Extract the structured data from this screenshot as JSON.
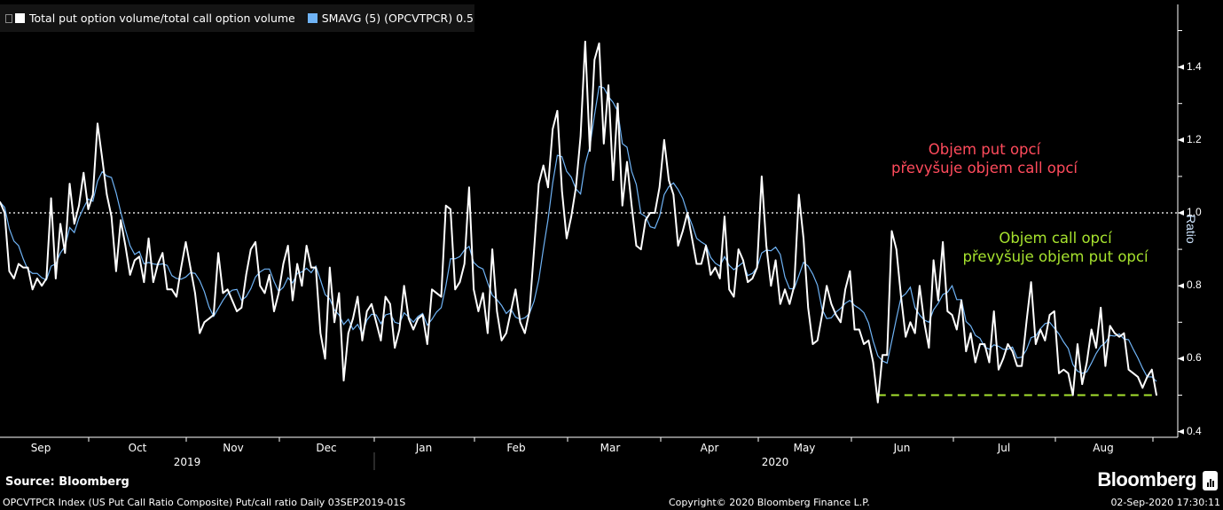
{
  "legend": {
    "series1": "Total put option volume/total call option volume",
    "series2": "SMAVG (5) (OPCVTPCR) 0.5",
    "series1_color": "#ffffff",
    "series2_color": "#6fb3f5"
  },
  "annotations": {
    "put_line1": "Objem put opcí",
    "put_line2": "převyšuje objem call opcí",
    "put_color": "#ff4b5c",
    "call_line1": "Objem call opcí",
    "call_line2": "převyšuje objem put opcí",
    "call_color": "#a6e22e"
  },
  "footer": {
    "source": "Source: Bloomberg",
    "description": "OPCVTPCR Index (US Put Call Ratio Composite) Put/call ratio  Daily 03SEP2019-01S",
    "copyright": "Copyright© 2020 Bloomberg Finance L.P.",
    "timestamp": "02-Sep-2020 17:30:11",
    "logo": "Bloomberg"
  },
  "chart_data": {
    "type": "line",
    "ylabel": "Ratio",
    "ylim": [
      0.4,
      1.52
    ],
    "yticks": [
      "1.4",
      "1.2",
      "1.0",
      "0.8",
      "0.6",
      "0.4"
    ],
    "xticks": [
      "Sep",
      "Oct",
      "Nov",
      "Dec",
      "Jan",
      "Feb",
      "Mar",
      "Apr",
      "May",
      "Jun",
      "Jul",
      "Aug"
    ],
    "years": [
      "2019",
      "2020"
    ],
    "reference_line": 1.0,
    "support_line": 0.5,
    "sma_period": 5,
    "series": [
      {
        "name": "Total put option volume/total call option volume",
        "color": "#ffffff",
        "values": [
          1.03,
          1.0,
          0.84,
          0.82,
          0.86,
          0.85,
          0.85,
          0.79,
          0.82,
          0.8,
          0.82,
          1.04,
          0.82,
          0.97,
          0.89,
          1.08,
          0.97,
          1.02,
          1.11,
          1.01,
          1.05,
          1.245,
          1.15,
          1.05,
          0.99,
          0.84,
          0.98,
          0.91,
          0.83,
          0.87,
          0.88,
          0.81,
          0.93,
          0.81,
          0.86,
          0.89,
          0.79,
          0.79,
          0.77,
          0.85,
          0.92,
          0.85,
          0.78,
          0.67,
          0.7,
          0.71,
          0.72,
          0.89,
          0.78,
          0.79,
          0.76,
          0.73,
          0.74,
          0.83,
          0.9,
          0.92,
          0.8,
          0.78,
          0.83,
          0.73,
          0.78,
          0.86,
          0.91,
          0.76,
          0.86,
          0.8,
          0.91,
          0.85,
          0.85,
          0.67,
          0.6,
          0.85,
          0.7,
          0.78,
          0.54,
          0.67,
          0.71,
          0.77,
          0.65,
          0.73,
          0.75,
          0.7,
          0.65,
          0.77,
          0.75,
          0.63,
          0.68,
          0.8,
          0.71,
          0.68,
          0.71,
          0.72,
          0.64,
          0.79,
          0.78,
          0.77,
          1.02,
          1.01,
          0.79,
          0.81,
          0.86,
          1.07,
          0.79,
          0.73,
          0.78,
          0.67,
          0.9,
          0.73,
          0.65,
          0.67,
          0.73,
          0.79,
          0.7,
          0.67,
          0.73,
          0.9,
          1.08,
          1.13,
          1.07,
          1.23,
          1.28,
          1.06,
          0.93,
          0.99,
          1.07,
          1.21,
          1.47,
          1.17,
          1.42,
          1.465,
          1.19,
          1.35,
          1.09,
          1.3,
          1.02,
          1.14,
          1.02,
          0.91,
          0.9,
          0.98,
          1.0,
          1.0,
          1.07,
          1.2,
          1.09,
          1.05,
          0.91,
          0.95,
          1.0,
          0.93,
          0.86,
          0.86,
          0.91,
          0.83,
          0.85,
          0.82,
          0.99,
          0.79,
          0.77,
          0.9,
          0.87,
          0.81,
          0.82,
          0.85,
          1.1,
          0.91,
          0.8,
          0.87,
          0.75,
          0.79,
          0.75,
          0.8,
          1.05,
          0.93,
          0.74,
          0.64,
          0.65,
          0.72,
          0.8,
          0.75,
          0.72,
          0.7,
          0.79,
          0.84,
          0.68,
          0.68,
          0.64,
          0.65,
          0.59,
          0.48,
          0.61,
          0.61,
          0.95,
          0.9,
          0.77,
          0.66,
          0.7,
          0.67,
          0.8,
          0.7,
          0.63,
          0.87,
          0.76,
          0.92,
          0.73,
          0.72,
          0.68,
          0.76,
          0.62,
          0.67,
          0.59,
          0.64,
          0.64,
          0.59,
          0.73,
          0.57,
          0.6,
          0.64,
          0.62,
          0.58,
          0.58,
          0.7,
          0.81,
          0.64,
          0.68,
          0.65,
          0.72,
          0.73,
          0.56,
          0.57,
          0.56,
          0.5,
          0.64,
          0.53,
          0.59,
          0.68,
          0.63,
          0.74,
          0.58,
          0.69,
          0.67,
          0.66,
          0.67,
          0.57,
          0.56,
          0.55,
          0.52,
          0.55,
          0.57,
          0.5
        ]
      },
      {
        "name": "SMAVG (5) (OPCVTPCR)",
        "color": "#6fb3f5",
        "last_value": 0.5
      }
    ]
  }
}
